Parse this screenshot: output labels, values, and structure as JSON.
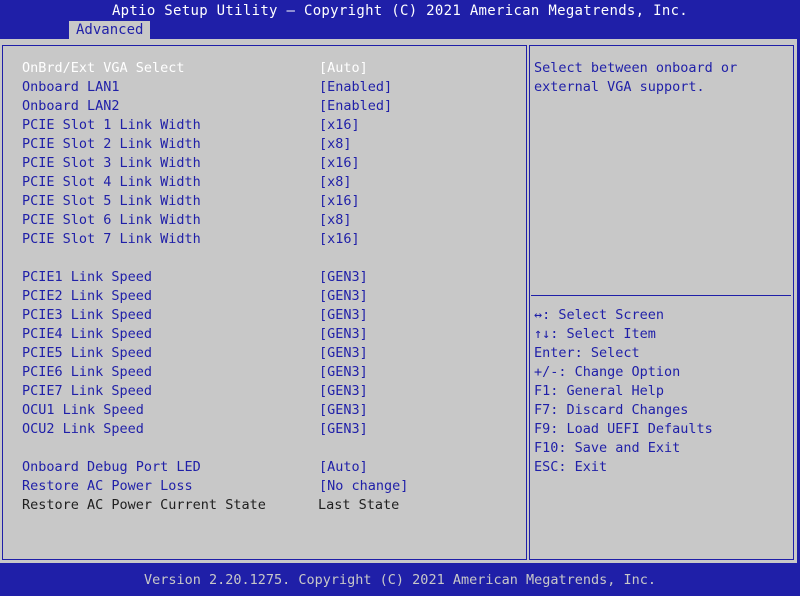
{
  "header": {
    "title": "Aptio Setup Utility – Copyright (C) 2021 American Megatrends, Inc.",
    "active_tab": "Advanced"
  },
  "settings": [
    {
      "label": "OnBrd/Ext VGA Select",
      "value": "[Auto]",
      "state": "selected"
    },
    {
      "label": "Onboard LAN1",
      "value": "[Enabled]",
      "state": "normal"
    },
    {
      "label": "Onboard LAN2",
      "value": "[Enabled]",
      "state": "normal"
    },
    {
      "label": "PCIE Slot 1 Link Width",
      "value": "[x16]",
      "state": "normal"
    },
    {
      "label": "PCIE Slot 2 Link Width",
      "value": "[x8]",
      "state": "normal"
    },
    {
      "label": "PCIE Slot 3 Link Width",
      "value": "[x16]",
      "state": "normal"
    },
    {
      "label": "PCIE Slot 4 Link Width",
      "value": "[x8]",
      "state": "normal"
    },
    {
      "label": "PCIE Slot 5 Link Width",
      "value": "[x16]",
      "state": "normal"
    },
    {
      "label": "PCIE Slot 6 Link Width",
      "value": "[x8]",
      "state": "normal"
    },
    {
      "label": "PCIE Slot 7 Link Width",
      "value": "[x16]",
      "state": "normal"
    },
    {
      "label": "PCIE1 Link Speed",
      "value": "[GEN3]",
      "state": "normal"
    },
    {
      "label": "PCIE2 Link Speed",
      "value": "[GEN3]",
      "state": "normal"
    },
    {
      "label": "PCIE3 Link Speed",
      "value": "[GEN3]",
      "state": "normal"
    },
    {
      "label": "PCIE4 Link Speed",
      "value": "[GEN3]",
      "state": "normal"
    },
    {
      "label": "PCIE5 Link Speed",
      "value": "[GEN3]",
      "state": "normal"
    },
    {
      "label": "PCIE6 Link Speed",
      "value": "[GEN3]",
      "state": "normal"
    },
    {
      "label": "PCIE7 Link Speed",
      "value": "[GEN3]",
      "state": "normal"
    },
    {
      "label": "OCU1 Link Speed",
      "value": "[GEN3]",
      "state": "normal"
    },
    {
      "label": "OCU2 Link Speed",
      "value": "[GEN3]",
      "state": "normal"
    },
    {
      "label": "Onboard Debug Port LED",
      "value": "[Auto]",
      "state": "normal"
    },
    {
      "label": "Restore AC Power Loss",
      "value": "[No change]",
      "state": "normal"
    },
    {
      "label": "Restore AC Power Current State",
      "value": "Last State",
      "state": "readonly"
    }
  ],
  "help_text": "Select between onboard or external VGA support.",
  "key_legend": [
    "↔: Select Screen",
    "↑↓: Select Item",
    "Enter: Select",
    "+/-: Change Option",
    "F1: General Help",
    "F7: Discard Changes",
    "F9: Load UEFI Defaults",
    "F10: Save and Exit",
    "ESC: Exit"
  ],
  "footer": "Version 2.20.1275. Copyright (C) 2021 American Megatrends, Inc.",
  "colors": {
    "background": "#1f1fa8",
    "panel": "#c8c8c8",
    "selected_text": "#ffffff",
    "normal_text": "#1f1fa8",
    "readonly_text": "#202020"
  }
}
